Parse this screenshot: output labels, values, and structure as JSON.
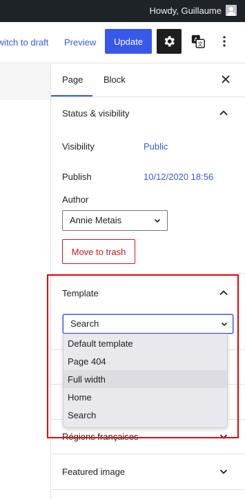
{
  "admin_bar": {
    "greeting": "Howdy, Guillaume"
  },
  "toolbar": {
    "switch_to_draft": "Switch to draft",
    "preview": "Preview",
    "update": "Update"
  },
  "sidebar": {
    "tabs": [
      "Page",
      "Block"
    ],
    "active_tab": "Page",
    "status_visibility": {
      "title": "Status & visibility",
      "visibility_label": "Visibility",
      "visibility_value": "Public",
      "publish_label": "Publish",
      "publish_value": "10/12/2020 18:56",
      "author_label": "Author",
      "author_value": "Annie Metais",
      "trash_label": "Move to trash"
    },
    "template": {
      "title": "Template",
      "selected": "Search",
      "options": [
        "Default template",
        "Page 404",
        "Full width",
        "Home",
        "Search"
      ],
      "highlighted_option": "Full width"
    },
    "regions_panel_title": "Régions françaises",
    "featured_image_title": "Featured image"
  },
  "colors": {
    "accent": "#3858e9",
    "danger": "#cc1818",
    "annotation": "#e00000",
    "admin_bar": "#1d2327"
  }
}
